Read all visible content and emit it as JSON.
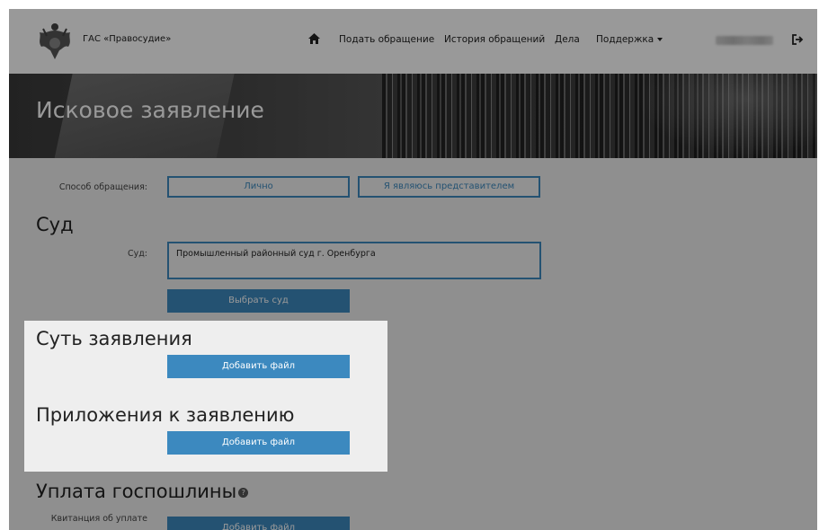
{
  "header": {
    "brand": "ГАС «Правосудие»",
    "nav": {
      "submit": "Подать обращение",
      "history": "История обращений",
      "cases": "Дела",
      "support": "Поддержка"
    },
    "icons": {
      "home": "home-icon",
      "logout": "logout-icon",
      "emblem": "coat-of-arms-icon"
    }
  },
  "banner": {
    "title": "Исковое заявление"
  },
  "appeal_method": {
    "label": "Способ обращения:",
    "option_personal": "Лично",
    "option_representative": "Я являюсь представителем"
  },
  "court_section": {
    "heading": "Суд",
    "label": "Суд:",
    "value": "Промышленный районный суд г. Оренбурга",
    "choose_button": "Выбрать суд"
  },
  "essence_section": {
    "heading": "Суть заявления",
    "add_file": "Добавить файл"
  },
  "attachments_section": {
    "heading": "Приложения к заявлению",
    "add_file": "Добавить файл"
  },
  "fee_section": {
    "heading": "Уплата госпошлины",
    "receipt_label": "Квитанция об уплате",
    "add_file": "Добавить файл"
  },
  "colors": {
    "accent": "#3c89bf",
    "overlay": "rgba(0,0,0,0.4)"
  }
}
